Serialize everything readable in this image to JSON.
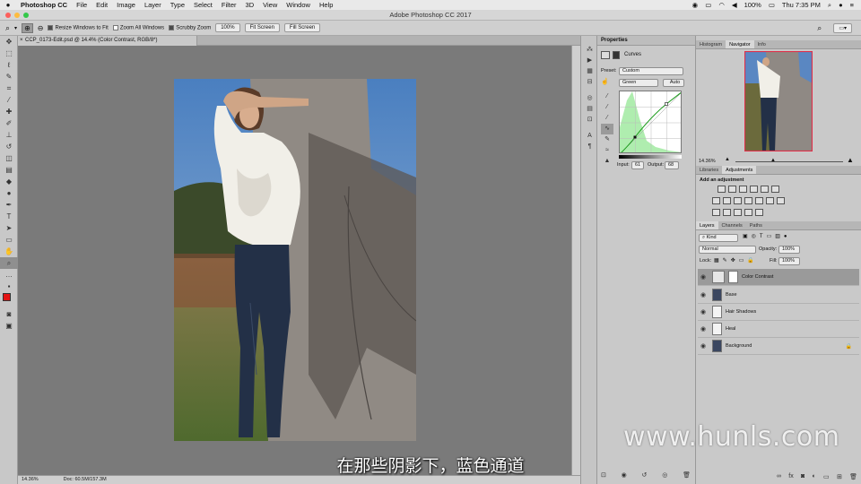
{
  "menubar": {
    "app_name": "Photoshop CC",
    "items": [
      "File",
      "Edit",
      "Image",
      "Layer",
      "Type",
      "Select",
      "Filter",
      "3D",
      "View",
      "Window",
      "Help"
    ],
    "battery": "100%",
    "clock": "Thu 7:35 PM"
  },
  "window": {
    "title": "Adobe Photoshop CC 2017"
  },
  "options": {
    "resize_windows": "Resize Windows to Fit",
    "zoom_all": "Zoom All Windows",
    "scrubby": "Scrubby Zoom",
    "btn_100": "100%",
    "btn_fit": "Fit Screen",
    "btn_fill": "Fill Screen"
  },
  "document": {
    "tab_title": "CCP_0173-Edit.psd @ 14.4% (Color Contrast, RGB/8*)",
    "status_zoom": "14.36%",
    "status_doc": "Doc: 60.5M/157.3M"
  },
  "properties": {
    "tab": "Properties",
    "adj_name": "Curves",
    "preset_label": "Preset:",
    "preset_value": "Custom",
    "channel": "Green",
    "auto_label": "Auto",
    "input_label": "Input:",
    "input_value": "61",
    "output_label": "Output:",
    "output_value": "68"
  },
  "navigator": {
    "tabs": [
      "Histogram",
      "Navigator",
      "Info"
    ],
    "zoom": "14.36%"
  },
  "adjustments": {
    "tabs": [
      "Libraries",
      "Adjustments"
    ],
    "header": "Add an adjustment"
  },
  "layers_panel": {
    "tabs": [
      "Layers",
      "Channels",
      "Paths"
    ],
    "kind": "Kind",
    "blend_mode": "Normal",
    "opacity_label": "Opacity:",
    "opacity_value": "100%",
    "lock_label": "Lock:",
    "fill_label": "Fill:",
    "fill_value": "100%",
    "layers": [
      {
        "name": "Color Contrast"
      },
      {
        "name": "Base"
      },
      {
        "name": "Hair Shadows"
      },
      {
        "name": "Heal"
      },
      {
        "name": "Background"
      }
    ]
  },
  "overlay": {
    "subtitle": "在那些阴影下，蓝色通道",
    "watermark": "www.hunls.com"
  }
}
